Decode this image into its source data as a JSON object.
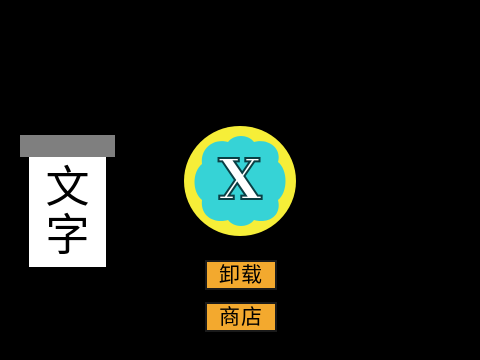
{
  "text_card": {
    "chars": [
      "文",
      "字"
    ]
  },
  "close_button": {
    "symbol": "X",
    "icon": "close-icon"
  },
  "buttons": {
    "uninstall_label": "卸载",
    "store_label": "商店"
  },
  "colors": {
    "background": "#000000",
    "circle_fill": "#f6ee38",
    "x_fill": "#36d3d6",
    "button_fill": "#f3a92e",
    "card_bar": "#7f7f7f",
    "card_body": "#ffffff"
  }
}
